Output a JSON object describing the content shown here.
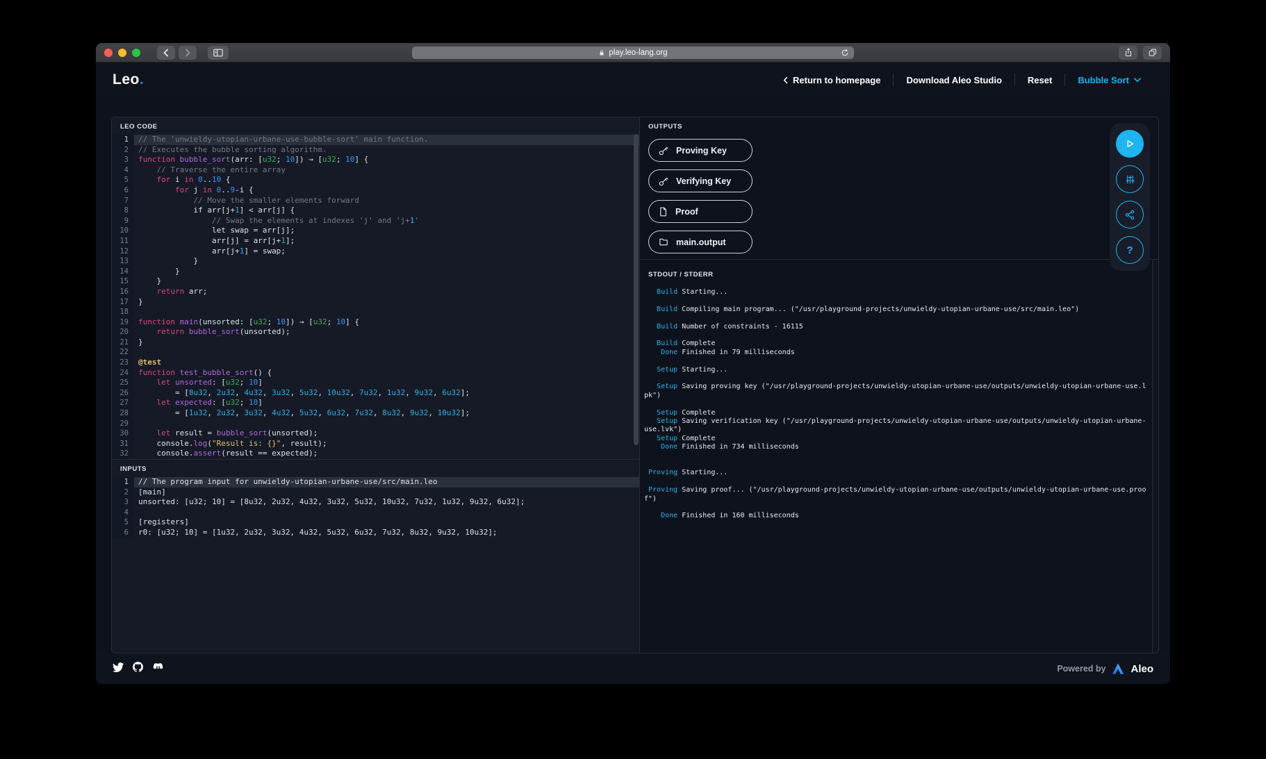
{
  "colors": {
    "accent_cyan": "#1db4ef",
    "logo_blue": "#2e7cf6",
    "keyword_pink": "#e0457b",
    "function_purple": "#b168dd",
    "type_green": "#3fae52",
    "number_blue": "#3f92f1",
    "literal_cyan": "#2fb1e8",
    "string_gold": "#e3bf6e",
    "comment_gray": "#707a86",
    "log_label_cyan": "#29b2e8"
  },
  "browser": {
    "url": "play.leo-lang.org"
  },
  "header": {
    "logo": "Leo",
    "logo_dot": ".",
    "nav": {
      "return": "Return to homepage",
      "download": "Download Aleo Studio",
      "reset": "Reset",
      "example": "Bubble Sort"
    }
  },
  "editor": {
    "title": "LEO CODE",
    "lines": [
      {
        "n": "1",
        "a": true,
        "t": [
          [
            "cm",
            "// The 'unwieldy-utopian-urbane-use-bubble-sort' main function."
          ]
        ]
      },
      {
        "n": "2",
        "t": [
          [
            "cm",
            "// Executes the bubble sorting algorithm."
          ]
        ]
      },
      {
        "n": "3",
        "t": [
          [
            "kw",
            "function"
          ],
          [
            "pl",
            " "
          ],
          [
            "fn",
            "bubble_sort"
          ],
          [
            "pl",
            "(arr: ["
          ],
          [
            "ty",
            "u32"
          ],
          [
            "pl",
            "; "
          ],
          [
            "num",
            "10"
          ],
          [
            "pl",
            "]) → ["
          ],
          [
            "ty",
            "u32"
          ],
          [
            "pl",
            "; "
          ],
          [
            "num",
            "10"
          ],
          [
            "pl",
            "] {"
          ]
        ]
      },
      {
        "n": "4",
        "t": [
          [
            "pl",
            "    "
          ],
          [
            "cm",
            "// Traverse the entire array"
          ]
        ]
      },
      {
        "n": "5",
        "t": [
          [
            "pl",
            "    "
          ],
          [
            "kw",
            "for"
          ],
          [
            "pl",
            " i "
          ],
          [
            "kw",
            "in"
          ],
          [
            "pl",
            " "
          ],
          [
            "num",
            "0"
          ],
          [
            "pl",
            ".."
          ],
          [
            "num",
            "10"
          ],
          [
            "pl",
            " {"
          ]
        ]
      },
      {
        "n": "6",
        "t": [
          [
            "pl",
            "        "
          ],
          [
            "kw",
            "for"
          ],
          [
            "pl",
            " j "
          ],
          [
            "kw",
            "in"
          ],
          [
            "pl",
            " "
          ],
          [
            "num",
            "0"
          ],
          [
            "pl",
            ".."
          ],
          [
            "num",
            "9"
          ],
          [
            "pl",
            "-i {"
          ]
        ]
      },
      {
        "n": "7",
        "t": [
          [
            "pl",
            "            "
          ],
          [
            "cm",
            "// Move the smaller elements forward"
          ]
        ]
      },
      {
        "n": "8",
        "t": [
          [
            "pl",
            "            if arr[j+"
          ],
          [
            "lit",
            "1"
          ],
          [
            "pl",
            "] < arr[j] {"
          ]
        ]
      },
      {
        "n": "9",
        "t": [
          [
            "pl",
            "                "
          ],
          [
            "cm",
            "// Swap the elements at indexes 'j' and 'j+"
          ],
          [
            "lit",
            "1"
          ],
          [
            "cm",
            "'"
          ]
        ]
      },
      {
        "n": "10",
        "t": [
          [
            "pl",
            "                let swap = arr[j];"
          ]
        ]
      },
      {
        "n": "11",
        "t": [
          [
            "pl",
            "                arr[j] = arr[j+"
          ],
          [
            "lit",
            "1"
          ],
          [
            "pl",
            "];"
          ]
        ]
      },
      {
        "n": "12",
        "t": [
          [
            "pl",
            "                arr[j+"
          ],
          [
            "lit",
            "1"
          ],
          [
            "pl",
            "] = swap;"
          ]
        ]
      },
      {
        "n": "13",
        "t": [
          [
            "pl",
            "            }"
          ]
        ]
      },
      {
        "n": "14",
        "t": [
          [
            "pl",
            "        }"
          ]
        ]
      },
      {
        "n": "15",
        "t": [
          [
            "pl",
            "    }"
          ]
        ]
      },
      {
        "n": "16",
        "t": [
          [
            "pl",
            "    "
          ],
          [
            "kw",
            "return"
          ],
          [
            "pl",
            " arr;"
          ]
        ]
      },
      {
        "n": "17",
        "t": [
          [
            "pl",
            "}"
          ]
        ]
      },
      {
        "n": "18",
        "t": []
      },
      {
        "n": "19",
        "t": [
          [
            "kw",
            "function"
          ],
          [
            "pl",
            " "
          ],
          [
            "fn",
            "main"
          ],
          [
            "pl",
            "(unsorted: ["
          ],
          [
            "ty",
            "u32"
          ],
          [
            "pl",
            "; "
          ],
          [
            "num",
            "10"
          ],
          [
            "pl",
            "]) → ["
          ],
          [
            "ty",
            "u32"
          ],
          [
            "pl",
            "; "
          ],
          [
            "num",
            "10"
          ],
          [
            "pl",
            "] {"
          ]
        ]
      },
      {
        "n": "20",
        "t": [
          [
            "pl",
            "    "
          ],
          [
            "kw",
            "return"
          ],
          [
            "pl",
            " "
          ],
          [
            "fn",
            "bubble_sort"
          ],
          [
            "pl",
            "(unsorted);"
          ]
        ]
      },
      {
        "n": "21",
        "t": [
          [
            "pl",
            "}"
          ]
        ]
      },
      {
        "n": "22",
        "t": []
      },
      {
        "n": "23",
        "t": [
          [
            "attr",
            "@test"
          ]
        ]
      },
      {
        "n": "24",
        "t": [
          [
            "kw",
            "function"
          ],
          [
            "pl",
            " "
          ],
          [
            "fn",
            "test_bubble_sort"
          ],
          [
            "pl",
            "() {"
          ]
        ]
      },
      {
        "n": "25",
        "t": [
          [
            "pl",
            "    "
          ],
          [
            "kw",
            "let"
          ],
          [
            "pl",
            " "
          ],
          [
            "fn",
            "unsorted"
          ],
          [
            "pl",
            ": ["
          ],
          [
            "ty",
            "u32"
          ],
          [
            "pl",
            "; "
          ],
          [
            "num",
            "10"
          ],
          [
            "pl",
            "]"
          ]
        ]
      },
      {
        "n": "26",
        "t": [
          [
            "pl",
            "        = ["
          ],
          [
            "lit",
            "8u32"
          ],
          [
            "pl",
            ", "
          ],
          [
            "lit",
            "2u32"
          ],
          [
            "pl",
            ", "
          ],
          [
            "lit",
            "4u32"
          ],
          [
            "pl",
            ", "
          ],
          [
            "lit",
            "3u32"
          ],
          [
            "pl",
            ", "
          ],
          [
            "lit",
            "5u32"
          ],
          [
            "pl",
            ", "
          ],
          [
            "lit",
            "10u32"
          ],
          [
            "pl",
            ", "
          ],
          [
            "lit",
            "7u32"
          ],
          [
            "pl",
            ", "
          ],
          [
            "lit",
            "1u32"
          ],
          [
            "pl",
            ", "
          ],
          [
            "lit",
            "9u32"
          ],
          [
            "pl",
            ", "
          ],
          [
            "lit",
            "6u32"
          ],
          [
            "pl",
            "];"
          ]
        ]
      },
      {
        "n": "27",
        "t": [
          [
            "pl",
            "    "
          ],
          [
            "kw",
            "let"
          ],
          [
            "pl",
            " "
          ],
          [
            "fn",
            "expected"
          ],
          [
            "pl",
            ": ["
          ],
          [
            "ty",
            "u32"
          ],
          [
            "pl",
            "; "
          ],
          [
            "num",
            "10"
          ],
          [
            "pl",
            "]"
          ]
        ]
      },
      {
        "n": "28",
        "t": [
          [
            "pl",
            "        = ["
          ],
          [
            "lit",
            "1u32"
          ],
          [
            "pl",
            ", "
          ],
          [
            "lit",
            "2u32"
          ],
          [
            "pl",
            ", "
          ],
          [
            "lit",
            "3u32"
          ],
          [
            "pl",
            ", "
          ],
          [
            "lit",
            "4u32"
          ],
          [
            "pl",
            ", "
          ],
          [
            "lit",
            "5u32"
          ],
          [
            "pl",
            ", "
          ],
          [
            "lit",
            "6u32"
          ],
          [
            "pl",
            ", "
          ],
          [
            "lit",
            "7u32"
          ],
          [
            "pl",
            ", "
          ],
          [
            "lit",
            "8u32"
          ],
          [
            "pl",
            ", "
          ],
          [
            "lit",
            "9u32"
          ],
          [
            "pl",
            ", "
          ],
          [
            "lit",
            "10u32"
          ],
          [
            "pl",
            "];"
          ]
        ]
      },
      {
        "n": "29",
        "t": []
      },
      {
        "n": "30",
        "t": [
          [
            "pl",
            "    "
          ],
          [
            "kw",
            "let"
          ],
          [
            "pl",
            " result = "
          ],
          [
            "fn",
            "bubble_sort"
          ],
          [
            "pl",
            "(unsorted);"
          ]
        ]
      },
      {
        "n": "31",
        "t": [
          [
            "pl",
            "    console."
          ],
          [
            "fn",
            "log"
          ],
          [
            "pl",
            "("
          ],
          [
            "str",
            "\"Result is: {}\""
          ],
          [
            "pl",
            ", result);"
          ]
        ]
      },
      {
        "n": "32",
        "t": [
          [
            "pl",
            "    console."
          ],
          [
            "fn",
            "assert"
          ],
          [
            "pl",
            "(result == expected);"
          ]
        ]
      }
    ]
  },
  "inputs": {
    "title": "INPUTS",
    "lines": [
      {
        "n": "1",
        "a": true,
        "t": [
          [
            "pl",
            "// The program input for unwieldy-utopian-urbane-use/src/main.leo"
          ]
        ]
      },
      {
        "n": "2",
        "t": [
          [
            "pl",
            "[main]"
          ]
        ]
      },
      {
        "n": "3",
        "t": [
          [
            "pl",
            "unsorted: [u32; 10] = [8u32, 2u32, 4u32, 3u32, 5u32, 10u32, 7u32, 1u32, 9u32, 6u32];"
          ]
        ]
      },
      {
        "n": "4",
        "t": []
      },
      {
        "n": "5",
        "t": [
          [
            "pl",
            "[registers]"
          ]
        ]
      },
      {
        "n": "6",
        "t": [
          [
            "pl",
            "r0: [u32; 10] = [1u32, 2u32, 3u32, 4u32, 5u32, 6u32, 7u32, 8u32, 9u32, 10u32];"
          ]
        ]
      }
    ]
  },
  "outputs": {
    "title": "OUTPUTS",
    "buttons": [
      {
        "icon": "key-icon",
        "label": "Proving Key"
      },
      {
        "icon": "key-icon",
        "label": "Verifying Key"
      },
      {
        "icon": "document-icon",
        "label": "Proof"
      },
      {
        "icon": "folder-icon",
        "label": "main.output"
      }
    ]
  },
  "stdout": {
    "title": "STDOUT / STDERR",
    "lines": [
      {
        "label": "Build",
        "text": "Starting..."
      },
      {
        "label": "",
        "text": ""
      },
      {
        "label": "Build",
        "text": "Compiling main program... (\"/usr/playground-projects/unwieldy-utopian-urbane-use/src/main.leo\")"
      },
      {
        "label": "",
        "text": ""
      },
      {
        "label": "Build",
        "text": "Number of constraints - 16115"
      },
      {
        "label": "",
        "text": ""
      },
      {
        "label": "Build",
        "text": "Complete"
      },
      {
        "label": "Done",
        "text": "Finished in 79 milliseconds"
      },
      {
        "label": "",
        "text": ""
      },
      {
        "label": "Setup",
        "text": "Starting..."
      },
      {
        "label": "",
        "text": ""
      },
      {
        "label": "Setup",
        "text": "Saving proving key (\"/usr/playground-projects/unwieldy-utopian-urbane-use/outputs/unwieldy-utopian-urbane-use.l\npk\")"
      },
      {
        "label": "",
        "text": ""
      },
      {
        "label": "Setup",
        "text": "Complete"
      },
      {
        "label": "Setup",
        "text": "Saving verification key (\"/usr/playground-projects/unwieldy-utopian-urbane-use/outputs/unwieldy-utopian-urbane-\nuse.lvk\")"
      },
      {
        "label": "Setup",
        "text": "Complete"
      },
      {
        "label": "Done",
        "text": "Finished in 734 milliseconds"
      },
      {
        "label": "",
        "text": ""
      },
      {
        "label": "",
        "text": ""
      },
      {
        "label": "Proving",
        "text": "Starting..."
      },
      {
        "label": "",
        "text": ""
      },
      {
        "label": "Proving",
        "text": "Saving proof... (\"/usr/playground-projects/unwieldy-utopian-urbane-use/outputs/unwieldy-utopian-urbane-use.proo\nf\")"
      },
      {
        "label": "",
        "text": ""
      },
      {
        "label": "Done",
        "text": "Finished in 160 milliseconds"
      }
    ]
  },
  "footer": {
    "powered_by": "Powered by",
    "brand": "Aleo"
  }
}
